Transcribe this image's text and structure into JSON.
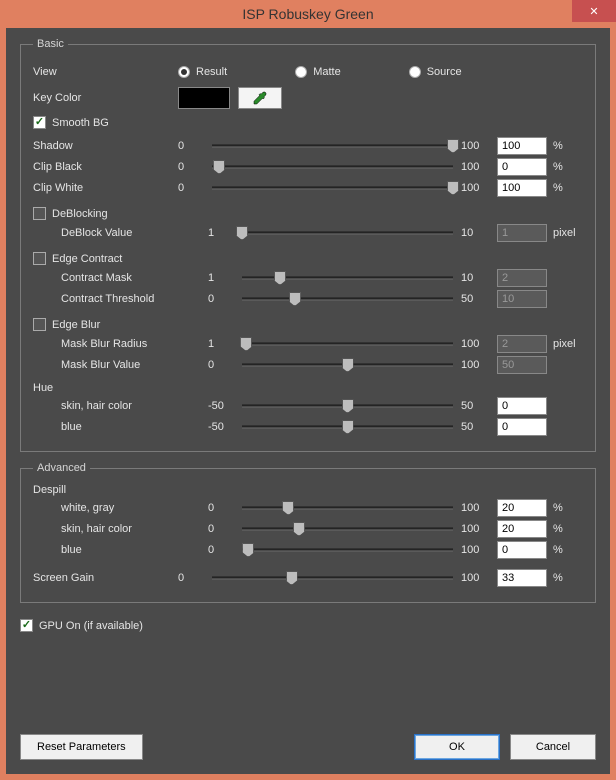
{
  "window": {
    "title": "ISP Robuskey Green"
  },
  "basic": {
    "legend": "Basic",
    "view_label": "View",
    "view_options": {
      "result": "Result",
      "matte": "Matte",
      "source": "Source"
    },
    "view_selected": "result",
    "key_color_label": "Key Color",
    "key_color": "#000000",
    "smooth_bg_label": "Smooth BG",
    "smooth_bg": true,
    "shadow": {
      "label": "Shadow",
      "min": "0",
      "max": "100",
      "value": "100",
      "unit": "%",
      "pos": 100
    },
    "clip_black": {
      "label": "Clip Black",
      "min": "0",
      "max": "100",
      "value": "0",
      "unit": "%",
      "pos": 3
    },
    "clip_white": {
      "label": "Clip White",
      "min": "0",
      "max": "100",
      "value": "100",
      "unit": "%",
      "pos": 100
    },
    "deblocking": {
      "label": "DeBlocking",
      "enabled": false,
      "deblock_value": {
        "label": "DeBlock Value",
        "min": "1",
        "max": "10",
        "value": "1",
        "unit": "pixel",
        "pos": 0
      }
    },
    "edge_contract": {
      "label": "Edge Contract",
      "enabled": false,
      "contract_mask": {
        "label": "Contract Mask",
        "min": "1",
        "max": "10",
        "value": "2",
        "pos": 18
      },
      "contract_threshold": {
        "label": "Contract Threshold",
        "min": "0",
        "max": "50",
        "value": "10",
        "pos": 25
      }
    },
    "edge_blur": {
      "label": "Edge Blur",
      "enabled": false,
      "mask_blur_radius": {
        "label": "Mask Blur Radius",
        "min": "1",
        "max": "100",
        "value": "2",
        "unit": "pixel",
        "pos": 2
      },
      "mask_blur_value": {
        "label": "Mask Blur Value",
        "min": "0",
        "max": "100",
        "value": "50",
        "pos": 50
      }
    },
    "hue": {
      "label": "Hue",
      "skin_hair": {
        "label": "skin, hair color",
        "min": "-50",
        "max": "50",
        "value": "0",
        "pos": 50
      },
      "blue": {
        "label": "blue",
        "min": "-50",
        "max": "50",
        "value": "0",
        "pos": 50
      }
    }
  },
  "advanced": {
    "legend": "Advanced",
    "despill_label": "Despill",
    "white_gray": {
      "label": "white, gray",
      "min": "0",
      "max": "100",
      "value": "20",
      "unit": "%",
      "pos": 22
    },
    "skin_hair": {
      "label": "skin, hair color",
      "min": "0",
      "max": "100",
      "value": "20",
      "unit": "%",
      "pos": 27
    },
    "blue": {
      "label": "blue",
      "min": "0",
      "max": "100",
      "value": "0",
      "unit": "%",
      "pos": 3
    },
    "screen_gain": {
      "label": "Screen Gain",
      "min": "0",
      "max": "100",
      "value": "33",
      "unit": "%",
      "pos": 33
    }
  },
  "gpu": {
    "label": "GPU On (if available)",
    "enabled": true
  },
  "buttons": {
    "reset": "Reset Parameters",
    "ok": "OK",
    "cancel": "Cancel"
  }
}
